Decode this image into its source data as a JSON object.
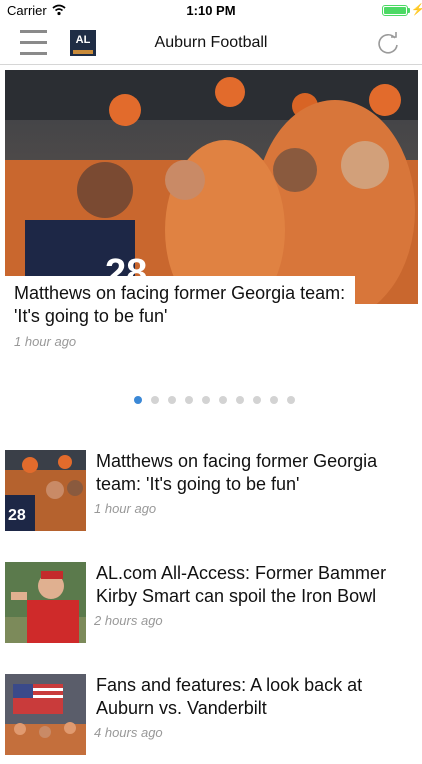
{
  "status_bar": {
    "carrier": "Carrier",
    "time": "1:10 PM",
    "battery_level": 1.0,
    "wifi_icon": "wifi-icon",
    "charging_icon": "bolt-icon"
  },
  "navbar": {
    "title": "Auburn Football",
    "logo_text": "AL",
    "menu_icon": "hamburger-icon",
    "refresh_icon": "refresh-icon"
  },
  "featured": {
    "title": "Matthews on facing former Georgia team: 'It's going to be fun'",
    "time": "1 hour ago",
    "slide_count": 10,
    "active_slide": 1
  },
  "articles": [
    {
      "title": "Matthews on facing former Georgia team: 'It's going to be fun'",
      "time": "1 hour ago"
    },
    {
      "title": "AL.com All-Access: Former Bammer Kirby Smart can spoil the Iron Bowl",
      "time": "2 hours ago"
    },
    {
      "title": "Fans and features: A look back at Auburn vs. Vanderbilt",
      "time": "4 hours ago"
    }
  ],
  "colors": {
    "active_dot": "#3b88d6",
    "inactive_dot": "#d3d3d3",
    "timestamp": "#999999",
    "battery": "#4cd964"
  }
}
